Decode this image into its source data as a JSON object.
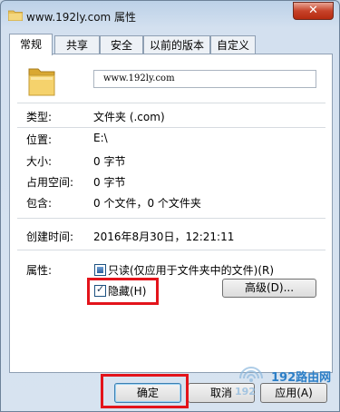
{
  "window": {
    "title": "www.192ly.com 属性",
    "close_glyph": "✕",
    "colors": {
      "title_bg": "#bcd1e8",
      "close_button": "#c7432a",
      "highlight": "#e3141b"
    }
  },
  "tabs": [
    {
      "label": "常规",
      "active": true
    },
    {
      "label": "共享"
    },
    {
      "label": "安全"
    },
    {
      "label": "以前的版本"
    },
    {
      "label": "自定义"
    }
  ],
  "general": {
    "name_value": "www.192ly.com",
    "type_label": "类型:",
    "type_value": "文件夹 (.com)",
    "location_label": "位置:",
    "location_value": "E:\\",
    "size_label": "大小:",
    "size_value": "0 字节",
    "size_on_disk_label": "占用空间:",
    "size_on_disk_value": "0 字节",
    "contains_label": "包含:",
    "contains_value": "0 个文件，0 个文件夹",
    "created_label": "创建时间:",
    "created_value": "2016年8月30日，12:21:11",
    "attributes_label": "属性:",
    "readonly_label": "只读(仅应用于文件夹中的文件)(R)",
    "readonly_state": "indeterminate",
    "hidden_label": "隐藏(H)",
    "hidden_checked": true,
    "advanced_label": "高级(D)..."
  },
  "buttons": {
    "ok": "确定",
    "cancel": "取消",
    "apply": "应用(A)"
  },
  "watermark": {
    "text": "192路由网",
    "subtext": "192",
    "color": "#2c7fc7"
  }
}
